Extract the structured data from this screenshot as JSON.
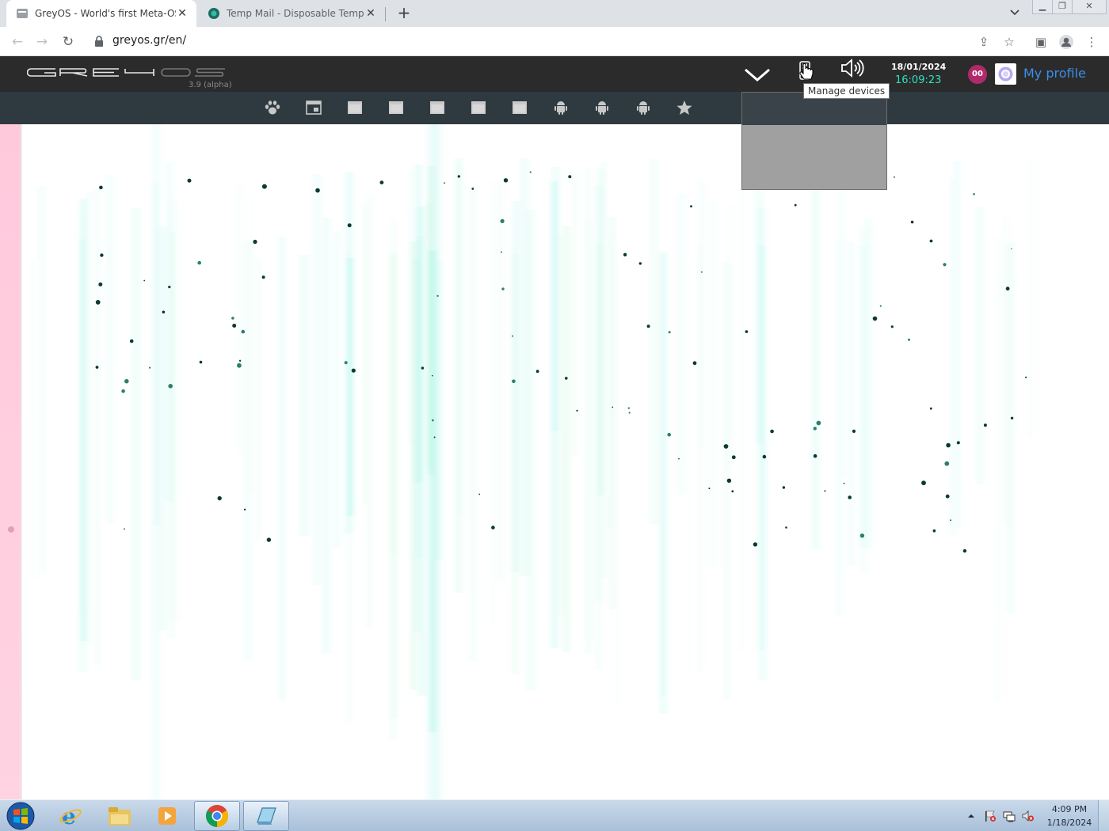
{
  "browser": {
    "tabs": [
      {
        "title": "GreyOS - World's first Meta-OS",
        "active": true,
        "favicon": "greyos-favicon"
      },
      {
        "title": "Temp Mail - Disposable Tempora",
        "active": false,
        "favicon": "tempmail-favicon"
      }
    ],
    "new_tab_glyph": "+",
    "close_glyph": "✕",
    "url": "greyos.gr/en/"
  },
  "greyos": {
    "logo_text": "GreyOS",
    "version": "3.9 (alpha)",
    "clock": {
      "date": "18/01/2024",
      "time": "16:09:23"
    },
    "notifications_badge": "00",
    "profile_label": "My profile",
    "tooltip": "Manage devices",
    "header_icons": [
      "chevron-down-icon",
      "device-icon",
      "speaker-icon"
    ],
    "dock_items": [
      {
        "name": "paw-icon"
      },
      {
        "name": "calendar-icon"
      },
      {
        "name": "window-icon"
      },
      {
        "name": "window-icon"
      },
      {
        "name": "window-icon"
      },
      {
        "name": "window-icon"
      },
      {
        "name": "window-icon"
      },
      {
        "name": "android-icon"
      },
      {
        "name": "android-icon"
      },
      {
        "name": "android-icon"
      },
      {
        "name": "star-icon"
      }
    ],
    "accent_color": "#2fe0c0",
    "badge_color": "#b02a6b",
    "link_color": "#3b8ee8"
  },
  "taskbar": {
    "apps": [
      "internet-explorer-icon",
      "file-explorer-icon",
      "media-player-icon",
      "chrome-icon",
      "generic-app-icon"
    ],
    "time": "4:09 PM",
    "date": "1/18/2024",
    "tray_icons": [
      "show-hidden-icons",
      "action-center-flag-icon",
      "network-icon",
      "volume-muted-icon"
    ]
  }
}
